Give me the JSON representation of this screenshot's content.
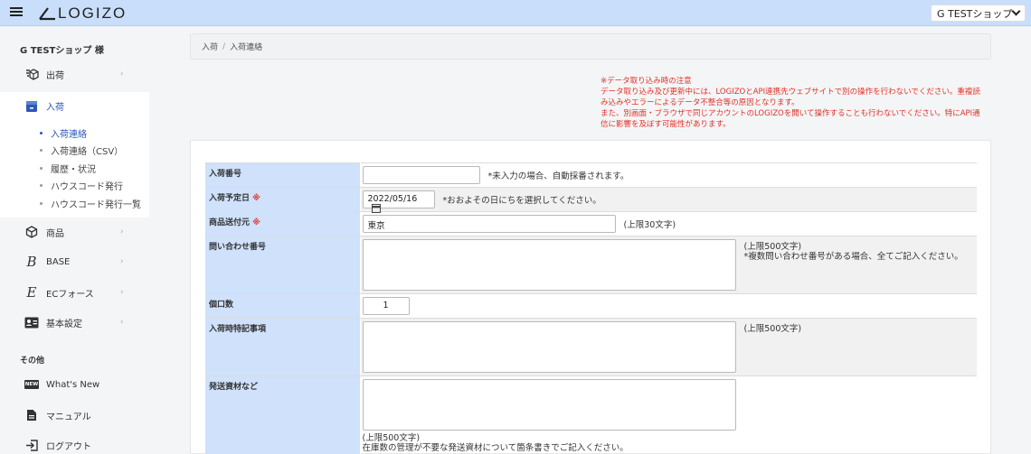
{
  "header": {
    "logo": "LOGIZO",
    "shop_select": "G TESTショップ"
  },
  "sidebar": {
    "shop_name": "G TESTショップ 様",
    "items": {
      "shipping": {
        "label": "出荷",
        "icon": "truck-icon"
      },
      "receiving": {
        "label": "入荷",
        "icon": "box-icon"
      },
      "products": {
        "label": "商品",
        "icon": "cube-icon"
      },
      "base": {
        "label": "BASE",
        "icon": "base-logo-icon"
      },
      "ecforce": {
        "label": "ECフォース",
        "icon": "ecforce-logo-icon"
      },
      "settings": {
        "label": "基本設定",
        "icon": "id-card-icon"
      }
    },
    "sub_items": [
      "入荷連絡",
      "入荷連絡（CSV）",
      "履歴・状況",
      "ハウスコード発行",
      "ハウスコード発行一覧"
    ],
    "other_label": "その他",
    "other_items": {
      "whats_new": {
        "label": "What's New",
        "badge": "NEW"
      },
      "manual": {
        "label": "マニュアル"
      },
      "logout": {
        "label": "ログアウト"
      }
    }
  },
  "breadcrumb": {
    "root": "入荷",
    "current": "入荷連絡"
  },
  "notice": {
    "title": "※データ取り込み時の注意",
    "line1": "データ取り込み及び更新中には、LOGIZOとAPI連携先ウェブサイトで別の操作を行わないでください。重複読み込みやエラーによるデータ不整合等の原因となります。",
    "line2": "また、別画面・ブラウザで同じアカウントのLOGIZOを開いて操作することも行わないでください。特にAPI通信に影響を及ぼす可能性があります。"
  },
  "form": {
    "arrival_number": {
      "label": "入荷番号",
      "value": "",
      "hint": "*未入力の場合、自動採番されます。"
    },
    "arrival_date": {
      "label": "入荷予定日",
      "required": "※",
      "value": "2022/05/16",
      "hint": "*おおよその日にちを選択してください。"
    },
    "sender": {
      "label": "商品送付元",
      "required": "※",
      "value": "東京",
      "hint": "(上限30文字)"
    },
    "inquiry_number": {
      "label": "問い合わせ番号",
      "hint1": "(上限500文字)",
      "hint2": "*複数問い合わせ番号がある場合、全てご記入ください。"
    },
    "box_count": {
      "label": "個口数",
      "value": "1"
    },
    "special_notes": {
      "label": "入荷時特記事項",
      "hint": "(上限500文字)"
    },
    "shipping_materials": {
      "label": "発送資材など",
      "hint1": "(上限500文字)",
      "hint2": "在庫数の管理が不要な発送資材について箇条書きでご記入ください。"
    }
  }
}
